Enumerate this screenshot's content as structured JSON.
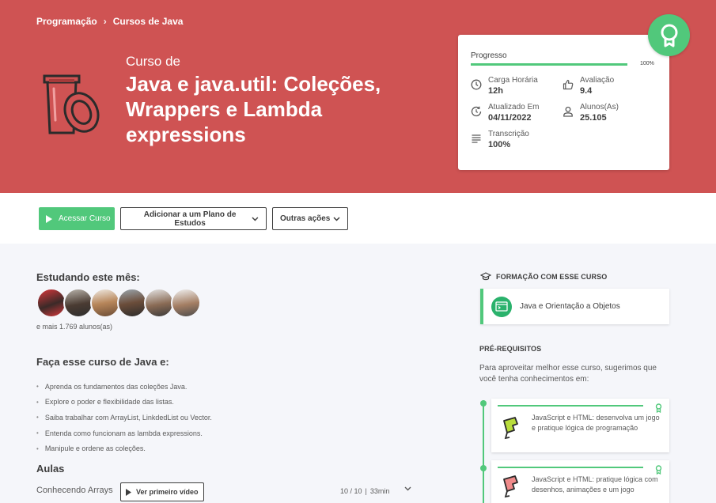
{
  "breadcrumb": {
    "category": "Programação",
    "subcategory": "Cursos de Java"
  },
  "course": {
    "kicker": "Curso de",
    "title": "Java e java.util: Coleções, Wrappers e Lambda expressions"
  },
  "stats": {
    "progress_label": "Progresso",
    "progress_pct_text": "100%",
    "progress_fraction": 1.0,
    "workload_label": "Carga Horária",
    "workload_value": "12h",
    "rating_label": "Avaliação",
    "rating_value": "9.4",
    "updated_label": "Atualizado Em",
    "updated_value": "04/11/2022",
    "students_label": "Alunos(As)",
    "students_value": "25.105",
    "transcript_label": "Transcrição",
    "transcript_value": "100%"
  },
  "actions": {
    "access": "Acessar Curso",
    "add_plan": "Adicionar a um Plano de Estudos",
    "other": "Outras ações"
  },
  "studying": {
    "heading": "Estudando este mês:",
    "more": "e mais 1.769 alunos(as)"
  },
  "objectives": {
    "heading": "Faça esse curso de Java e:",
    "items": [
      "Aprenda os fundamentos das coleções Java.",
      "Explore o poder e flexibilidade das listas.",
      "Saiba trabalhar com ArrayList, LinkdedList ou Vector.",
      "Entenda como funcionam as lambda expressions.",
      "Manipule e ordene as coleções."
    ]
  },
  "lessons": {
    "heading": "Aulas",
    "first": {
      "name": "Conhecendo Arrays",
      "video_button": "Ver primeiro vídeo",
      "count": "10 / 10",
      "duration": "33min"
    }
  },
  "sidebar": {
    "formation_heading": "FORMAÇÃO COM ESSE CURSO",
    "formation_item": "Java e Orientação a Objetos",
    "prereq_heading": "PRÉ-REQUISITOS",
    "prereq_text": "Para aproveitar melhor esse curso, sugerimos que você tenha conhecimentos em:",
    "prereqs": [
      {
        "title": "JavaScript e HTML: desenvolva um jogo e pratique lógica de programação"
      },
      {
        "title": "JavaScript e HTML: pratique lógica com desenhos, animações e um jogo"
      }
    ]
  },
  "colors": {
    "hero": "#cf5353",
    "accent": "#51c87b",
    "text": "#3d3d3d"
  }
}
